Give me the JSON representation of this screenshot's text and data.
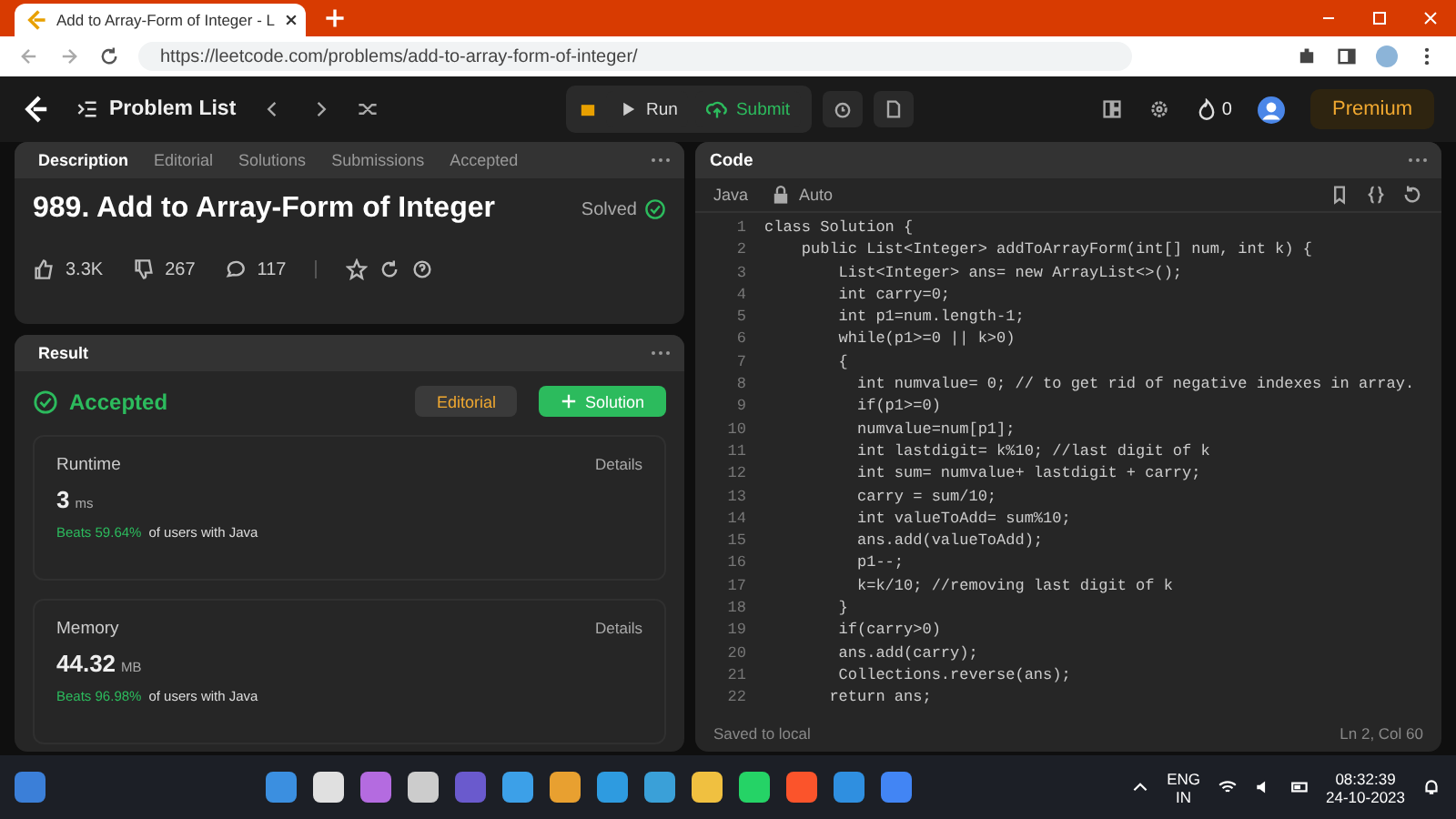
{
  "browser": {
    "tab_title": "Add to Array-Form of Integer - L",
    "url": "https://leetcode.com/problems/add-to-array-form-of-integer/"
  },
  "navbar": {
    "problem_list": "Problem List",
    "run": "Run",
    "submit": "Submit",
    "streak": "0",
    "premium": "Premium"
  },
  "description_panel": {
    "tabs": [
      {
        "label": "Description",
        "selected": true
      },
      {
        "label": "Editorial",
        "selected": false
      },
      {
        "label": "Solutions",
        "selected": false
      },
      {
        "label": "Submissions",
        "selected": false
      },
      {
        "label": "Accepted",
        "selected": false
      }
    ],
    "title": "989. Add to Array-Form of Integer",
    "status": "Solved",
    "likes": "3.3K",
    "dislikes": "267",
    "comments": "117"
  },
  "result_panel": {
    "tab": "Result",
    "verdict": "Accepted",
    "editorial_button": "Editorial",
    "solution_button": "Solution",
    "cards": [
      {
        "label": "Runtime",
        "details": "Details",
        "value": "3",
        "unit": "ms",
        "beats": "Beats 59.64%",
        "suffix": "of users with Java"
      },
      {
        "label": "Memory",
        "details": "Details",
        "value": "44.32",
        "unit": "MB",
        "beats": "Beats 96.98%",
        "suffix": "of users with Java"
      }
    ]
  },
  "code_panel": {
    "title": "Code",
    "language": "Java",
    "mode": "Auto",
    "status": "Saved to local",
    "cursor": "Ln 2, Col 60",
    "lines": [
      {
        "number": "1",
        "text": "class Solution {"
      },
      {
        "number": "2",
        "text": "    public List<Integer> addToArrayForm(int[] num, int k) {"
      },
      {
        "number": "3",
        "text": "        List<Integer> ans= new ArrayList<>();"
      },
      {
        "number": "4",
        "text": "        int carry=0;"
      },
      {
        "number": "5",
        "text": "        int p1=num.length-1;"
      },
      {
        "number": "6",
        "text": "        while(p1>=0 || k>0)"
      },
      {
        "number": "7",
        "text": "        {"
      },
      {
        "number": "8",
        "text": "          int numvalue= 0; // to get rid of negative indexes in array."
      },
      {
        "number": "9",
        "text": "          if(p1>=0)"
      },
      {
        "number": "10",
        "text": "          numvalue=num[p1];"
      },
      {
        "number": "11",
        "text": "          int lastdigit= k%10; //last digit of k"
      },
      {
        "number": "12",
        "text": "          int sum= numvalue+ lastdigit + carry;"
      },
      {
        "number": "13",
        "text": "          carry = sum/10;"
      },
      {
        "number": "14",
        "text": "          int valueToAdd= sum%10;"
      },
      {
        "number": "15",
        "text": "          ans.add(valueToAdd);"
      },
      {
        "number": "16",
        "text": "          p1--;"
      },
      {
        "number": "17",
        "text": "          k=k/10; //removing last digit of k"
      },
      {
        "number": "18",
        "text": "        }"
      },
      {
        "number": "19",
        "text": "        if(carry>0)"
      },
      {
        "number": "20",
        "text": "        ans.add(carry);"
      },
      {
        "number": "21",
        "text": "        Collections.reverse(ans);"
      },
      {
        "number": "22",
        "text": "       return ans;"
      }
    ]
  },
  "taskbar": {
    "language": "ENG",
    "region": "IN",
    "time": "08:32:39",
    "date": "24-10-2023",
    "apps": [
      {
        "color": "#3b8fe0"
      },
      {
        "color": "#e0e0e0"
      },
      {
        "color": "#b46be0"
      },
      {
        "color": "#cccccc"
      },
      {
        "color": "#6a5acd"
      },
      {
        "color": "#3ca0e8"
      },
      {
        "color": "#e8a030"
      },
      {
        "color": "#2e9be0"
      },
      {
        "color": "#3aa0d8"
      },
      {
        "color": "#f0c040"
      },
      {
        "color": "#25d366"
      },
      {
        "color": "#fb542b"
      },
      {
        "color": "#2f8fe0"
      },
      {
        "color": "#4285f4"
      }
    ]
  }
}
